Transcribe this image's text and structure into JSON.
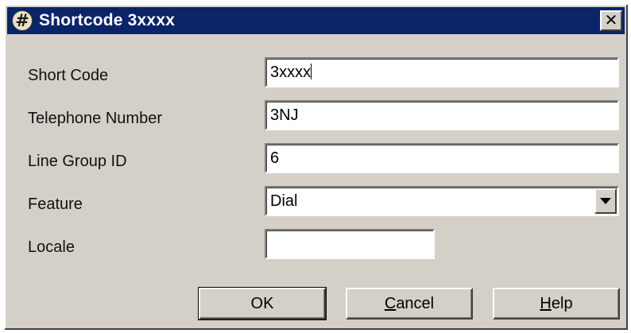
{
  "window": {
    "title": "Shortcode 3xxxx",
    "icon": "hash-icon",
    "icon_glyph": "#",
    "close_glyph": "✕"
  },
  "form": {
    "short_code": {
      "label": "Short Code",
      "value": "3xxxx"
    },
    "telephone_number": {
      "label": "Telephone Number",
      "value": "3NJ"
    },
    "line_group_id": {
      "label": "Line Group ID",
      "value": "6"
    },
    "feature": {
      "label": "Feature",
      "value": "Dial"
    },
    "locale": {
      "label": "Locale",
      "value": ""
    }
  },
  "buttons": {
    "ok": "OK",
    "cancel_first": "C",
    "cancel_rest": "ancel",
    "help_first": "H",
    "help_rest": "elp"
  },
  "colors": {
    "title_bar": "#0a246a",
    "dialog_face": "#d4d0c8"
  }
}
